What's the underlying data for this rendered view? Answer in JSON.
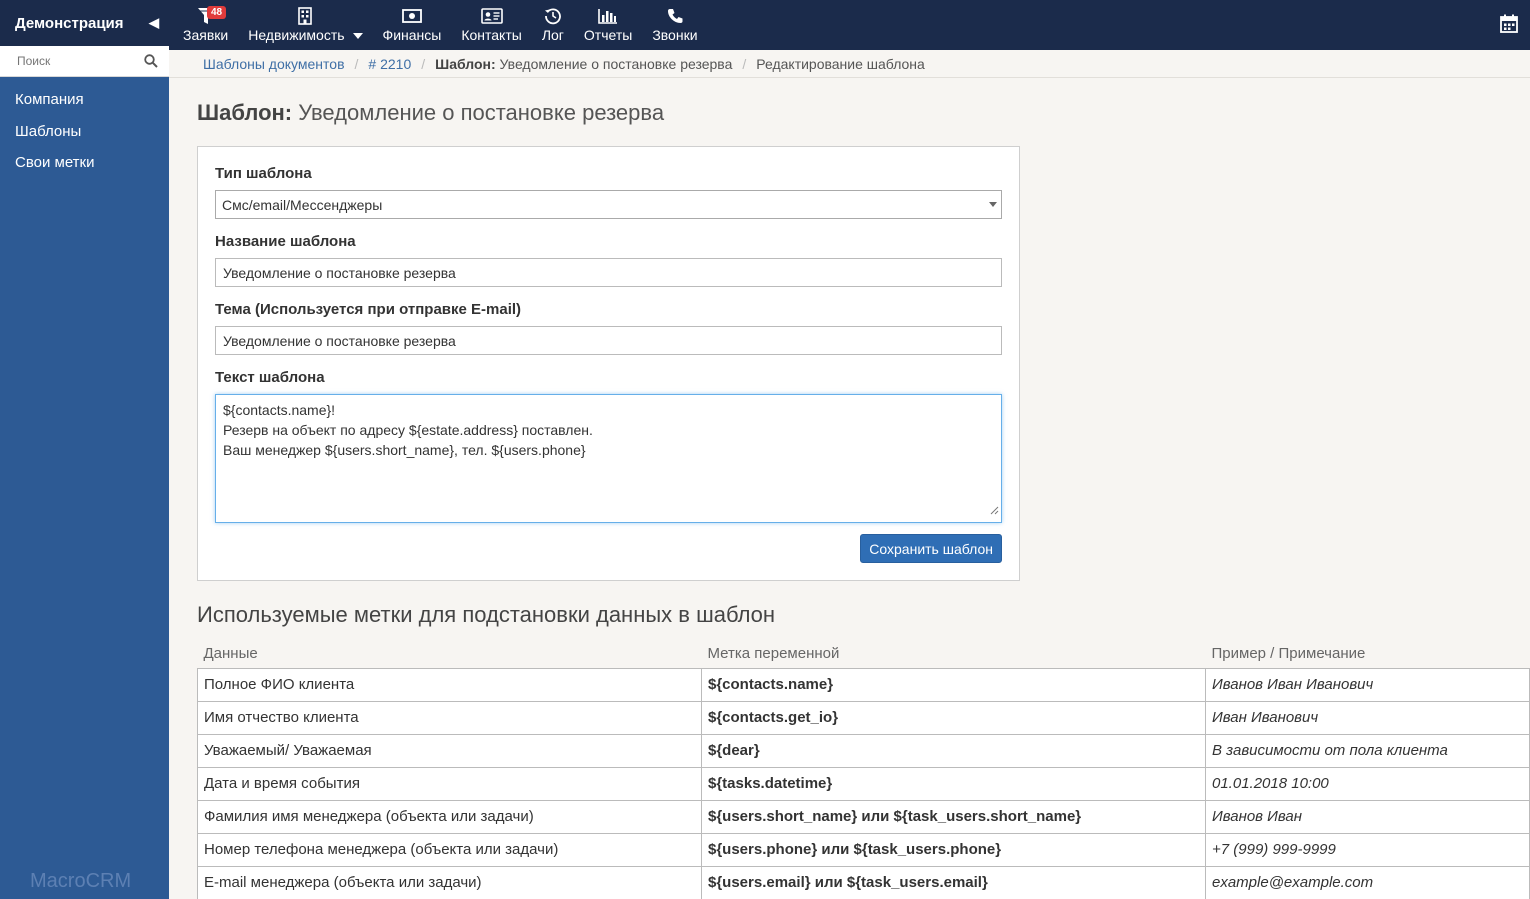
{
  "sidebar": {
    "title": "Демонстрация",
    "search_placeholder": "Поиск",
    "items": [
      {
        "label": "Компания"
      },
      {
        "label": "Шаблоны"
      },
      {
        "label": "Свои метки"
      }
    ],
    "brand": "MacroCRM",
    "bg_color": "#2d5a94"
  },
  "topnav": {
    "items": [
      {
        "label": "Заявки",
        "icon": "funnel-icon",
        "badge": "48"
      },
      {
        "label": "Недвижимость",
        "icon": "building-icon"
      },
      {
        "label": "Финансы",
        "icon": "money-icon"
      },
      {
        "label": "Контакты",
        "icon": "contact-card-icon"
      },
      {
        "label": "Лог",
        "icon": "history-icon"
      },
      {
        "label": "Отчеты",
        "icon": "bar-chart-icon"
      },
      {
        "label": "Звонки",
        "icon": "phone-icon"
      }
    ],
    "bg_color": "#1b2b4b"
  },
  "breadcrumb": {
    "items": [
      "Шаблоны документов",
      "# 2210"
    ],
    "current_bold": "Шаблон:",
    "current_rest": " Уведомление о постановке резерва",
    "last": "Редактирование шаблона"
  },
  "page": {
    "title_bold": "Шаблон:",
    "title_rest": " Уведомление о постановке резерва"
  },
  "form": {
    "type_label": "Тип шаблона",
    "type_value": "Смс/email/Мессенджеры",
    "name_label": "Название шаблона",
    "name_value": "Уведомление о постановке резерва",
    "subject_label": "Тема (Используется при отправке E-mail)",
    "subject_value": "Уведомление о постановке резерва",
    "text_label": "Текст шаблона",
    "text_lines": [
      "${contacts.name}!",
      "Резерв на объект по адресу ${estate.address} поставлен.",
      "Ваш менеджер ${users.short_name}, тел. ${users.phone}"
    ],
    "save_label": "Сохранить шаблон",
    "save_color": "#2f6eb5"
  },
  "tags": {
    "title": "Используемые метки для подстановки данных в шаблон",
    "headers": [
      "Данные",
      "Метка переменной",
      "Пример / Примечание"
    ],
    "rows": [
      {
        "data": "Полное ФИО клиента",
        "mark": "${contacts.name}",
        "example": "Иванов Иван Иванович"
      },
      {
        "data": "Имя отчество клиента",
        "mark": "${contacts.get_io}",
        "example": "Иван Иванович"
      },
      {
        "data": "Уважаемый/ Уважаемая",
        "mark": "${dear}",
        "example": "В зависимости от пола клиента"
      },
      {
        "data": "Дата и время события",
        "mark": "${tasks.datetime}",
        "example": "01.01.2018 10:00"
      },
      {
        "data": "Фамилия имя менеджера (объекта или задачи)",
        "mark": "${users.short_name} или ${task_users.short_name}",
        "example": "Иванов Иван"
      },
      {
        "data": "Номер телефона менеджера (объекта или задачи)",
        "mark": "${users.phone} или ${task_users.phone}",
        "example": "+7 (999) 999-9999"
      },
      {
        "data": "E-mail менеджера (объекта или задачи)",
        "mark": "${users.email} или ${task_users.email}",
        "example": "example@example.com"
      }
    ]
  }
}
